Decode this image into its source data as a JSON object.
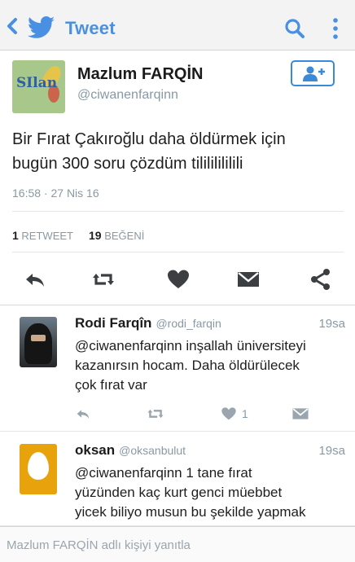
{
  "topbar": {
    "title": "Tweet"
  },
  "main_tweet": {
    "name": "Mazlum FARQİN",
    "handle": "@ciwanenfarqinn",
    "avatar_text": "SIlan",
    "text_line1": "Bir Fırat Çakıroğlu daha öldürmek için",
    "text_line2": "bugün 300 soru çözdüm tilililililili",
    "timestamp": "16:58 · 27 Nis 16",
    "retweet_count": "1",
    "retweet_label": "RETWEET",
    "like_count": "19",
    "like_label": "BEĞENİ"
  },
  "replies": [
    {
      "name": "Rodi Farqîn",
      "handle": "@rodi_farqin",
      "time": "19sa",
      "line1": "@ciwanenfarqinn inşallah üniversiteyi",
      "line2": "kazanırsın hocam. Daha öldürülecek",
      "line3": "çok fırat var",
      "likes": "1"
    },
    {
      "name": "oksan",
      "handle": "@oksanbulut",
      "time": "19sa",
      "line1": "@ciwanenfarqinn 1 tane fırat",
      "line2": "yüzünden kaç kurt genci müebbet",
      "line3": "yicek biliyo musun bu şekilde yapmak"
    }
  ],
  "compose": {
    "placeholder": "Mazlum FARQİN adlı kişiyi yanıtla"
  },
  "colors": {
    "accent": "#4a90e2",
    "icon_grey": "#3c3f41",
    "muted": "#8899a6"
  }
}
